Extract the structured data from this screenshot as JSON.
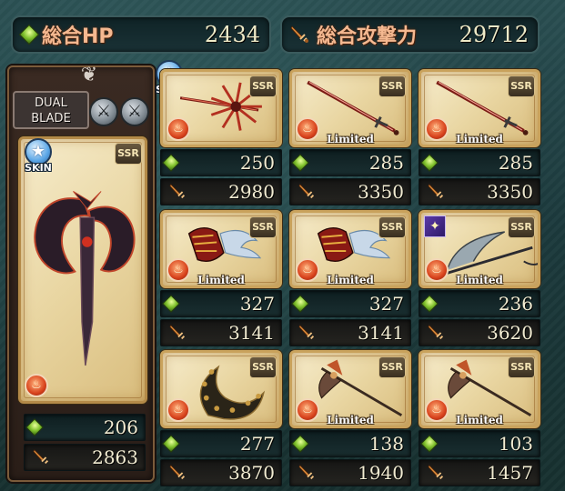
{
  "header": {
    "hp_label": "総合HP",
    "hp_value": "2434",
    "atk_label": "総合攻撃力",
    "atk_value": "29712"
  },
  "main_weapon": {
    "specialty_label": "DUAL\nBLADE",
    "skin_label": "SKIN",
    "weapon_skin_label": "SKIN",
    "rarity": "SSR",
    "hp": "206",
    "atk": "2863",
    "element": "fire"
  },
  "grid": [
    {
      "rarity": "SSR",
      "limited": "",
      "hp": "250",
      "atk": "2980",
      "element": "fire",
      "art": "star-blade"
    },
    {
      "rarity": "SSR",
      "limited": "Limited",
      "hp": "285",
      "atk": "3350",
      "element": "fire",
      "art": "long-sword"
    },
    {
      "rarity": "SSR",
      "limited": "Limited",
      "hp": "285",
      "atk": "3350",
      "element": "fire",
      "art": "long-sword"
    },
    {
      "rarity": "SSR",
      "limited": "Limited",
      "hp": "327",
      "atk": "3141",
      "element": "fire",
      "art": "gauntlet"
    },
    {
      "rarity": "SSR",
      "limited": "Limited",
      "hp": "327",
      "atk": "3141",
      "element": "fire",
      "art": "gauntlet"
    },
    {
      "rarity": "SSR",
      "limited": "Limited",
      "hp": "236",
      "atk": "3620",
      "element": "fire",
      "art": "scythe"
    },
    {
      "rarity": "SSR",
      "limited": "",
      "hp": "277",
      "atk": "3870",
      "element": "fire",
      "art": "thorn-blade"
    },
    {
      "rarity": "SSR",
      "limited": "Limited",
      "hp": "138",
      "atk": "1940",
      "element": "fire",
      "art": "halberd"
    },
    {
      "rarity": "SSR",
      "limited": "Limited",
      "hp": "103",
      "atk": "1457",
      "element": "fire",
      "art": "halberd"
    }
  ],
  "colors": {
    "hp_gem": "#7fc02c",
    "card_gold": "#c9a25c",
    "label_orange": "#f4b890",
    "fire": "#d8421c"
  }
}
